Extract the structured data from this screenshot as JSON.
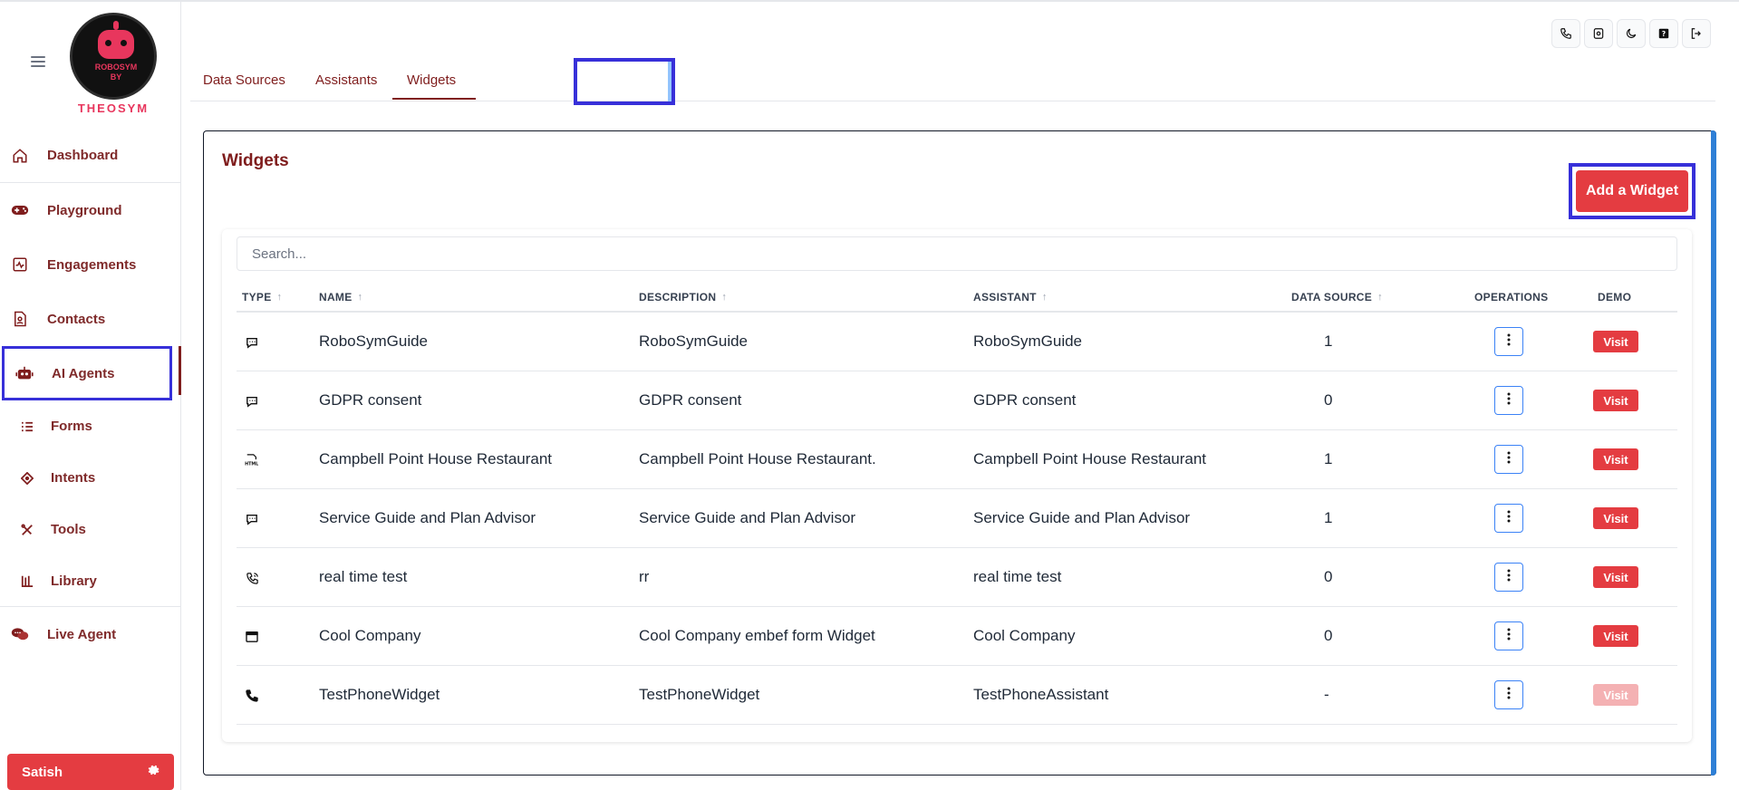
{
  "sidebar": {
    "logo_top": "ROBOSYM",
    "logo_by": "BY",
    "logo_brand": "THEOSYM",
    "items": [
      {
        "label": "Dashboard"
      },
      {
        "label": "Playground"
      },
      {
        "label": "Engagements"
      },
      {
        "label": "Contacts"
      },
      {
        "label": "AI Agents"
      },
      {
        "label": "Forms"
      },
      {
        "label": "Intents"
      },
      {
        "label": "Tools"
      },
      {
        "label": "Library"
      },
      {
        "label": "Live Agent"
      }
    ],
    "user": {
      "name": "Satish"
    }
  },
  "tabs": [
    {
      "label": "Data Sources"
    },
    {
      "label": "Assistants"
    },
    {
      "label": "Widgets"
    }
  ],
  "card": {
    "title": "Widgets",
    "add_label": "Add a Widget",
    "search_placeholder": "Search..."
  },
  "table": {
    "headers": [
      "TYPE",
      "NAME",
      "DESCRIPTION",
      "ASSISTANT",
      "DATA SOURCE",
      "OPERATIONS",
      "DEMO"
    ],
    "rows": [
      {
        "type": "chat",
        "name": "RoboSymGuide",
        "description": "RoboSymGuide",
        "assistant": "RoboSymGuide",
        "data_source": "1",
        "demo": "Visit"
      },
      {
        "type": "chat",
        "name": "GDPR consent",
        "description": "GDPR consent",
        "assistant": "GDPR consent",
        "data_source": "0",
        "demo": "Visit"
      },
      {
        "type": "html",
        "name": "Campbell Point House Restaurant",
        "description": "Campbell Point House Restaurant.",
        "assistant": "Campbell Point House Restaurant",
        "data_source": "1",
        "demo": "Visit"
      },
      {
        "type": "chat",
        "name": "Service Guide and Plan Advisor",
        "description": "Service Guide and Plan Advisor",
        "assistant": "Service Guide and Plan Advisor",
        "data_source": "1",
        "demo": "Visit"
      },
      {
        "type": "realtime-phone",
        "name": "real time test",
        "description": "rr",
        "assistant": "real time test",
        "data_source": "0",
        "demo": "Visit"
      },
      {
        "type": "form",
        "name": "Cool Company",
        "description": "Cool Company embef form Widget",
        "assistant": "Cool Company",
        "data_source": "0",
        "demo": "Visit"
      },
      {
        "type": "phone",
        "name": "TestPhoneWidget",
        "description": "TestPhoneWidget",
        "assistant": "TestPhoneAssistant",
        "data_source": "-",
        "demo": "Visit"
      }
    ]
  },
  "colors": {
    "brand_red": "#e43c41",
    "maroon": "#7f1d1d",
    "highlight": "#3730d9",
    "accent_blue": "#2e7fd6"
  }
}
